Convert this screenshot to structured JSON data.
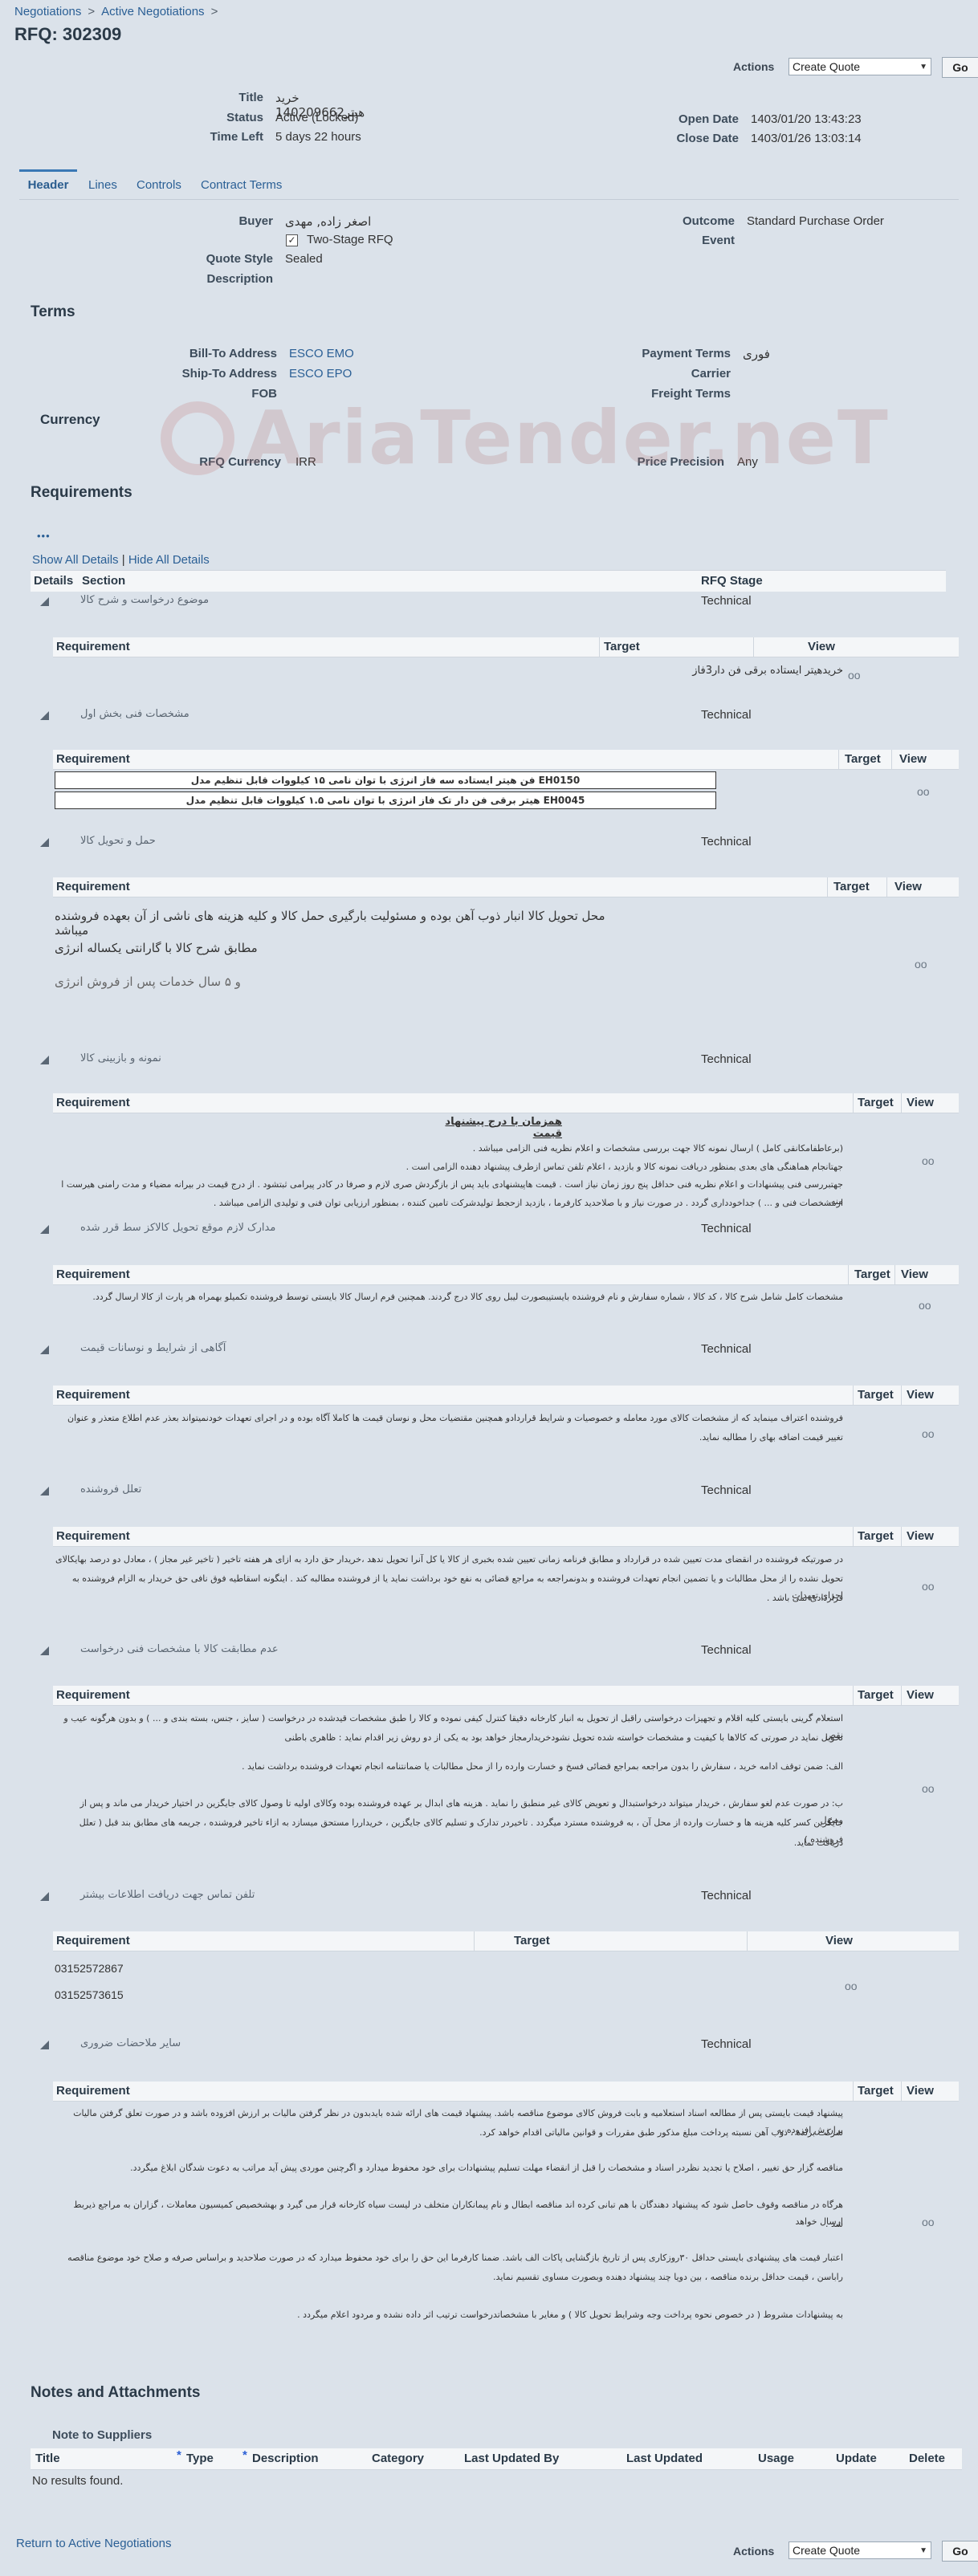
{
  "breadcrumb": [
    "Negotiations",
    "Active Negotiations"
  ],
  "breadcrumb_sep": ">",
  "page_title": "RFQ: 302309",
  "actions": {
    "label": "Actions",
    "selected": "Create Quote",
    "go": "Go"
  },
  "summary": {
    "title_label": "Title",
    "title_value": "خرید هیتر140209662",
    "status_label": "Status",
    "status_value": "Active (Locked)",
    "timeleft_label": "Time Left",
    "timeleft_value": "5 days 22 hours",
    "open_label": "Open Date",
    "open_value": "1403/01/20 13:43:23",
    "close_label": "Close Date",
    "close_value": "1403/01/26 13:03:14"
  },
  "tabs": [
    "Header",
    "Lines",
    "Controls",
    "Contract Terms"
  ],
  "header": {
    "buyer_label": "Buyer",
    "buyer_value": "اصغر زاده, مهدی",
    "two_stage": "Two-Stage RFQ",
    "quote_style_label": "Quote Style",
    "quote_style_value": "Sealed",
    "description_label": "Description",
    "outcome_label": "Outcome",
    "outcome_value": "Standard Purchase Order",
    "event_label": "Event"
  },
  "terms": {
    "heading": "Terms",
    "billto_label": "Bill-To Address",
    "billto_value": "ESCO EMO",
    "shipto_label": "Ship-To Address",
    "shipto_value": "ESCO EPO",
    "fob_label": "FOB",
    "payment_label": "Payment Terms",
    "payment_value": "فوری",
    "carrier_label": "Carrier",
    "freight_label": "Freight Terms"
  },
  "currency": {
    "heading": "Currency",
    "rfq_label": "RFQ Currency",
    "rfq_value": "IRR",
    "precision_label": "Price Precision",
    "precision_value": "Any"
  },
  "watermark": "AriaTender.neT",
  "requirements": {
    "heading": "Requirements",
    "dots": "•••",
    "show_all": "Show All Details",
    "hide_all": "Hide All Details",
    "sep": "|",
    "col_details": "Details",
    "col_section": "Section",
    "col_stage": "RFQ Stage",
    "col_requirement": "Requirement",
    "col_target": "Target",
    "col_view": "View",
    "stage": "Technical",
    "sections": [
      {
        "title": "موضوع درخواست و شرح کالا",
        "lines": [
          "خریدهیتر ایستاده برقی فن دار3فاز"
        ]
      },
      {
        "title": "مشخصات فنی بخش اول",
        "lines": [
          "EH0150 فن هیتر ایستاده سه فاز انرژی با توان نامی ۱۵ کیلووات قابل تنظیم مدل",
          "EH0045 هیتر برقی فن دار تک فاز انرژی با توان نامی ۱.۵ کیلووات قابل تنظیم مدل"
        ]
      },
      {
        "title": "حمل و تحویل کالا",
        "lines": [
          "محل تحویل کالا انبار ذوب آهن بوده و مسئولیت بارگیری حمل کالا و کلیه هزینه های ناشی از آن بعهده فروشنده میباشد",
          "مطابق شرح کالا با گارانتی یکساله انرژی",
          "و ۵ سال خدمات پس از فروش انرژی"
        ]
      },
      {
        "title": "نمونه و بازبینی کالا",
        "lines": [
          "همزمان با درج پیشنهاد قیمت",
          "(برعاطفامکانقی  کامل ) ارسال نمونه کالا جهت بررسی مشخصات و اعلام نظریه فنی الزامی میباشد .",
          "جهتانجام هماهنگی های بعدی بمنظور دریافت نمونه کالا و بازدید ، اعلام تلفن تماس ازطرف پیشنهاد دهنده الزامی است .",
          "جهتبررسی فنی پیشنهادات و اعلام نظریه فنی حداقل پنج روز زمان نیاز است . قیمت هاپیشنهادی باید پس از بازگردش صری لازم و صرفا در کادر پیرامی ثبتشود . از درج قیمت در بیرانه مضیاء و مدت رامنی هیرست ا منه.",
          "ازمشخصات فنی و ... ) جداخودداری گردد . در صورت نیاز و با صلاحدید کارفرما ، بازدید ازحجط تولیدشرکت تامین کننده ، بمنظور ارزیابی توان فنی و تولیدی الزامی میباشد ."
        ]
      },
      {
        "title": "مدارک لازم موقع تحویل کالاکز سط قرر شده",
        "lines": [
          "مشخصات کامل شامل شرح کالا ، کد کالا ، شماره سفارش و نام فروشنده بایستیبصورت لیبل روی کالا درج گردند. همچنین فرم ارسال کالا بایستی توسط فروشنده تکمیلو بهمراه هر پارت از کالا ارسال گردد."
        ]
      },
      {
        "title": "آگاهی از شرایط و نوسانات قیمت",
        "lines": [
          "فروشنده اعتراف مینماید که از مشخصات کالای مورد معامله و خصوصیات و شرایط قراردادو همچنین مقتضیات محل و نوسان قیمت ها کاملا آگاه بوده و در اجرای تعهدات خودنمیتواند بعذر عدم اطلاع متعذر و عنوان",
          "تغییر قیمت اضافه بهای را مطالبه نماید."
        ]
      },
      {
        "title": "تعلل فروشنده",
        "lines": [
          "در صورتیکه فروشنده در انقضای مدت تعیین شده در قرارداد و مطابق فرنامه زمانی تعیین شده بخبری از کالا یا کل آنرا تحویل ندهد ،خریدار حق دارد به ازای هر هفته تاخیر ( تاخیر غیر مجاز ) ، معادل دو درصد بهایکالای",
          "تحویل نشده را از محل مطالبات و یا تضمین انجام تعهدات فروشنده و بدونمراجعه به مراجع قضائی به نفع خود برداشت نماید یا از فروشنده مطالبه کند . اینگونه اسقاطیه فوق نافی حق خریدار به الزام فروشنده به اجرای تعهدات",
          "قراردادی نمی باشد ."
        ]
      },
      {
        "title": "عدم مطابقت کالا با مشخصات فنی درخواست",
        "lines": [
          "استعلام گرینی بایستی کلیه اقلام و تجهیزات درخواستی راقبل از تحویل به انبار کارخانه دقیقا کنترل کیفی نموده و کالا را طبق مشخصات قیدشده در درخواست ( سایز ، جنس، بسته بندی و ... ) و بدون هرگونه عیب و نقص",
          "تحویل نماید در صورتی که کالاها با کیفیت و مشخصات خواسته شده تحویل نشودخریدارمجاز خواهد بود به یکی از دو روش زیر اقدام نماید : ظاهری باطنی",
          "الف: ضمن توقف ادامه خرید ، سفارش را بدون مراجعه بمراجع قضائی فسخ و خسارت وارده را از محل مطالبات یا ضمانتنامه انجام تعهدات فروشنده برداشت نماید .",
          "ب: در صورت عدم لغو سفارش ، خریدار میتواند درخواستبدال و تعویض کالای غیر منطبق را نماید . هزینه های ابدال بر عهده فروشنده بوده وکالای اولیه تا وصول کالای جایگزین در اختیار خریدار می ماند و پس از وصول",
          "جایگزین کسر کلیه هزینه ها و خسارت وارده از محل آن ، به فروشنده مسترد میگردد . تاخیردر تدارک و تسلیم کالای جایگزین ، خریداررا مستحق میسازد به ازاء تاخیر فروشنده ، جریمه های مطابق بند قبل ( تعلل فروشنده )",
          "دریافت نماید."
        ]
      },
      {
        "title": "تلفن تماس جهت دریافت اطلاعات بیشتر",
        "lines": [
          "03152572867",
          "03152573615"
        ]
      },
      {
        "title": "سایر ملاحضات ضروری",
        "lines": [
          "پیشنهاد قیمت بایستی پس از مطالعه اسناد استعلامیه و بابت فروش کالای موضوع مناقصه باشد. پیشنهاد قیمت های ارائه شده بایدبدون در نظر گرفتن مالیات بر ارزش افزوده باشد و در صورت تعلق گرفتن مالیات برارزش افزوده به",
          "شرکت برنده ، ذوب آهن نسبته پرداخت مبلغ مذکور طبق مقررات و قوانین مالیاتی اقدام خواهد کرد.",
          "مناقصه گزار حق تغییر ، اصلاح یا تجدید نظردر اسناد و مشخصات را قبل از انقضاء مهلت تسلیم پیشنهادات برای خود محفوظ میدارد و اگرچنین موردی پیش آید مراتب به دعوت شدگان ابلاغ میگردد.",
          "هرگاه در مناقصه وقوف حاصل شود که پیشنهاد دهندگان با هم تبانی کرده اند مناقصه ابطال و نام پیمانکاران متخلف در لیست سیاه کارخانه قرار می گیرد و بهشخصیص کمیسیون معاملات ، گزاران به مراجع ذیربط ارسال خواهد",
          "شد .",
          "اعتبار قیمت های پیشنهادی بایستی حداقل ۳۰روزکاری پس از تاریخ بازگشایی پاکات الف باشد. ضمنا کارفرما این حق را برای خود محفوظ میدارد که در صورت صلاحدید و براساس صرفه و صلاح خود موضوع مناقصه",
          "راباسن ، قیمت حداقل برنده مناقصه ، بین دویا چند پیشنهاد دهنده وبصورت مساوی تقسیم نماید.",
          "به پیشنهادات مشروط ( در خصوص نحوه پرداخت وجه وشرایط تحویل کالا ) و مغایر با مشخصاتدرخواست ترتیب اثر داده نشده و مردود اعلام میگردد ."
        ]
      }
    ]
  },
  "notes": {
    "heading": "Notes and Attachments",
    "sub": "Note to Suppliers",
    "cols": [
      "Title",
      "Type",
      "Description",
      "Category",
      "Last Updated By",
      "Last Updated",
      "Usage",
      "Update",
      "Delete"
    ],
    "star": "*",
    "empty": "No results found."
  },
  "footer": {
    "return_link": "Return to Active Negotiations"
  }
}
